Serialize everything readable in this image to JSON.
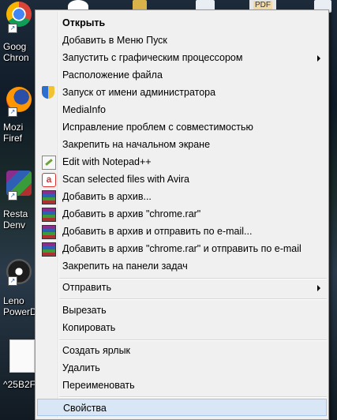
{
  "desktop": {
    "icons": [
      {
        "label": "Goog",
        "label2": "Chron",
        "icon": "chrome-icon"
      },
      {
        "label": "Mozi",
        "label2": "Firef",
        "icon": "firefox-icon"
      },
      {
        "label": "Resta",
        "label2": "Denv",
        "icon": "rar-archive-icon"
      },
      {
        "label": "Leno",
        "label2": "PowerD",
        "icon": "media-player-icon"
      },
      {
        "label": "^25B2F",
        "label2": "",
        "icon": "document-thumbnail-icon"
      }
    ],
    "top_pdf_label": "PDF"
  },
  "menu": {
    "items": [
      {
        "label": "Открыть",
        "bold": true,
        "icon": ""
      },
      {
        "label": "Добавить в Меню Пуск",
        "icon": ""
      },
      {
        "label": "Запустить с графическим процессором",
        "icon": "",
        "submenu": true
      },
      {
        "label": "Расположение файла",
        "icon": ""
      },
      {
        "label": "Запуск от имени администратора",
        "icon": "uac-shield-icon"
      },
      {
        "label": "MediaInfo",
        "icon": ""
      },
      {
        "label": "Исправление проблем с совместимостью",
        "icon": ""
      },
      {
        "label": "Закрепить на начальном экране",
        "icon": ""
      },
      {
        "label": "Edit with Notepad++",
        "icon": "notepadpp-icon"
      },
      {
        "label": "Scan selected files with Avira",
        "icon": "avira-icon"
      },
      {
        "label": "Добавить в архив...",
        "icon": "winrar-icon"
      },
      {
        "label": "Добавить в архив \"chrome.rar\"",
        "icon": "winrar-icon"
      },
      {
        "label": "Добавить в архив и отправить по e-mail...",
        "icon": "winrar-icon"
      },
      {
        "label": "Добавить в архив \"chrome.rar\" и отправить по e-mail",
        "icon": "winrar-icon"
      },
      {
        "label": "Закрепить на панели задач",
        "icon": ""
      },
      {
        "label": "Отправить",
        "icon": "",
        "submenu": true
      },
      {
        "label": "Вырезать",
        "icon": ""
      },
      {
        "label": "Копировать",
        "icon": ""
      },
      {
        "label": "Создать ярлык",
        "icon": ""
      },
      {
        "label": "Удалить",
        "icon": ""
      },
      {
        "label": "Переименовать",
        "icon": ""
      },
      {
        "label": "Свойства",
        "icon": "",
        "highlighted": true
      }
    ]
  }
}
